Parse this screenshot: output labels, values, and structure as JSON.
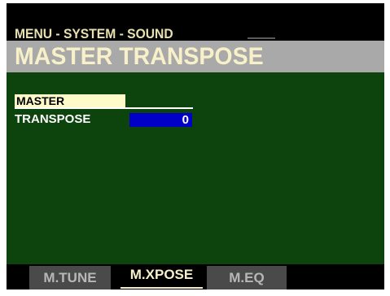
{
  "header": {
    "breadcrumb": "MENU - SYSTEM - SOUND",
    "title": "MASTER TRANSPOSE"
  },
  "main": {
    "section_label": "MASTER",
    "parameter_label": "TRANSPOSE",
    "parameter_value": "0"
  },
  "tabs": [
    {
      "label": "M.TUNE",
      "selected": false
    },
    {
      "label": "M.XPOSE",
      "selected": true
    },
    {
      "label": "M.EQ",
      "selected": false
    }
  ],
  "colors": {
    "screen_background": "#000000",
    "title_bar": "#a9a9a9",
    "body_background": "#0d430d",
    "value_highlight": "#0000c8",
    "section_highlight": "#fffbc8"
  }
}
